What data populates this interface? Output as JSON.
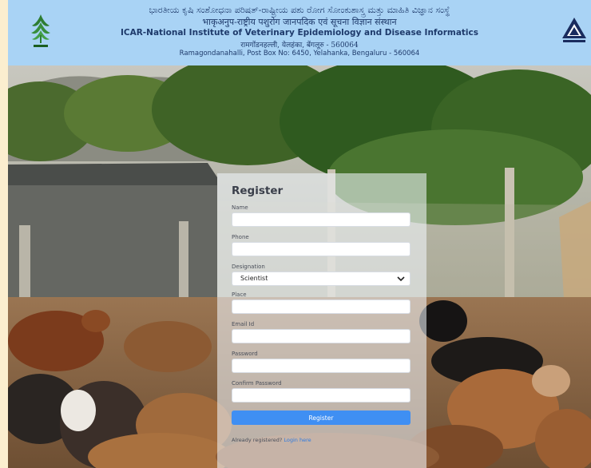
{
  "header": {
    "kannada": "ಭಾರತೀಯ ಕೃಷಿ ಸಂಶೋಧನಾ ಪರಿಷತ್-ರಾಷ್ಟ್ರೀಯ ಪಶು ರೋಗ ಸೋಂಕುಶಾಸ್ತ್ರ ಮತ್ತು ಮಾಹಿತಿ ವಿಜ್ಞಾನ ಸಂಸ್ಥೆ",
    "hindi": "भाकृअनुप-राष्ट्रीय पशुरोग जानपदिक एवं सूचना विज्ञान संस्थान",
    "english": "ICAR-National Institute of Veterinary Epidemiology and Disease Informatics",
    "hindi_address": "रामगोंडनहल्ली, येलहंका, बेंगलूरु - 560064",
    "address": "Ramagondanahalli, Post Box No: 6450, Yelahanka, Bengaluru - 560064"
  },
  "form": {
    "title": "Register",
    "name_label": "Name",
    "phone_label": "Phone",
    "designation_label": "Designation",
    "designation_value": "Scientist",
    "place_label": "Place",
    "email_label": "Email Id",
    "password_label": "Password",
    "confirm_label": "Confirm Password",
    "submit_label": "Register",
    "already_text": "Already registered?",
    "login_link": "Login here"
  },
  "colors": {
    "header_bg": "#a9d3f5",
    "button_bg": "#3f8ff3",
    "page_bg": "#fbeecf"
  }
}
